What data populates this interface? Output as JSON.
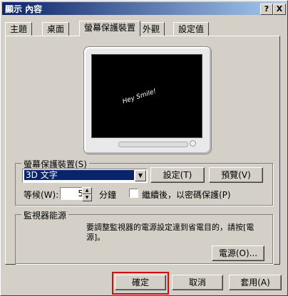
{
  "titlebar": {
    "title": "顯示 內容",
    "help": "?",
    "close": "X"
  },
  "tabs": [
    {
      "label": "主題",
      "active": false
    },
    {
      "label": "桌面",
      "active": false
    },
    {
      "label": "螢幕保護裝置",
      "active": true
    },
    {
      "label": "外觀",
      "active": false
    },
    {
      "label": "設定值",
      "active": false
    }
  ],
  "preview": {
    "text": "Hey Smile!"
  },
  "screensaver": {
    "group_label": "螢幕保護裝置(S)",
    "selected": "3D 文字",
    "settings_btn": "設定(T)",
    "preview_btn": "預覽(V)",
    "wait_label": "等候(W):",
    "wait_value": "5",
    "minutes": "分鐘",
    "password_checkbox": "繼續後，以密碼保護(P)",
    "password_checked": false
  },
  "power": {
    "group_label": "監視器能源",
    "description": "要調整監視器的電源設定達到省電目的，請按[電源]。",
    "power_btn": "電源(O)..."
  },
  "footer": {
    "ok": "確定",
    "cancel": "取消",
    "apply": "套用(A)"
  },
  "colors": {
    "title_bar": "#0a246a",
    "focus_highlight": "#d01010",
    "selection": "#0a246a"
  }
}
